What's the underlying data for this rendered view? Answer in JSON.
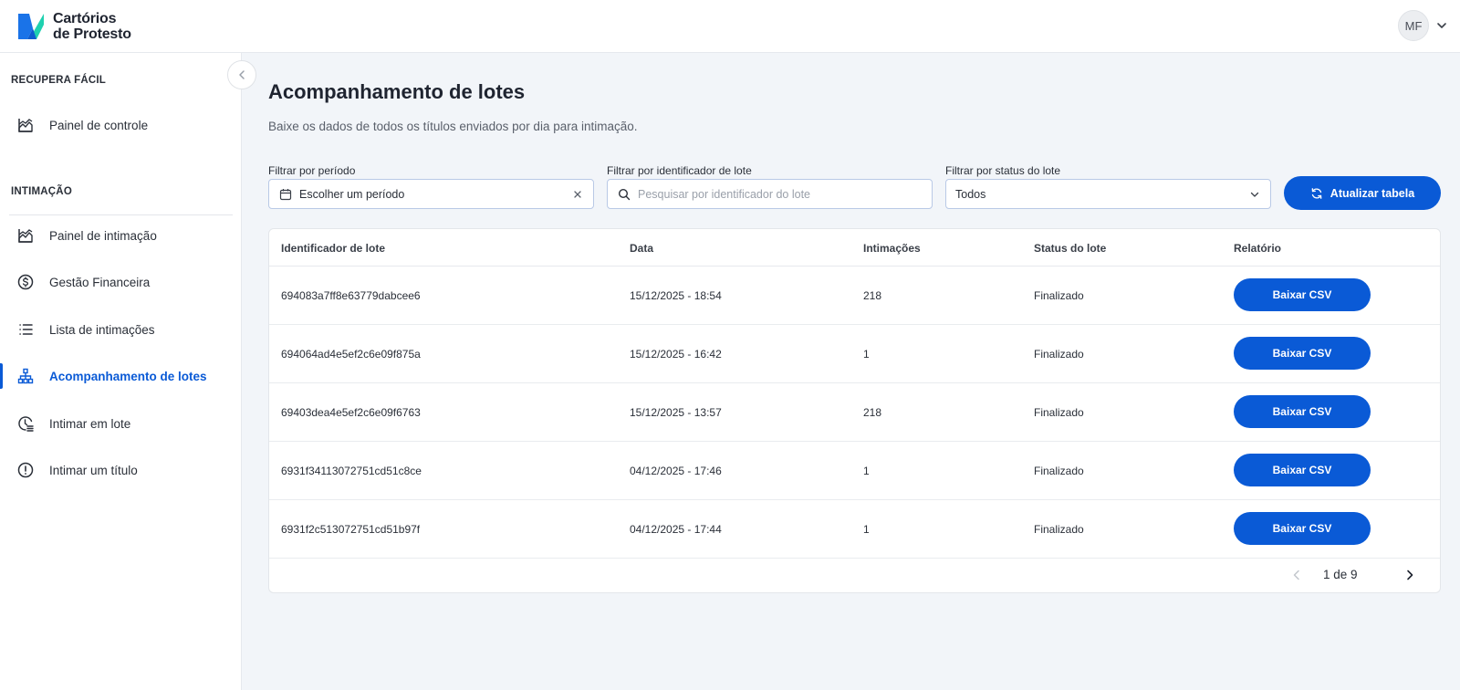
{
  "brand": {
    "name_line1": "Cartórios",
    "name_line2": "de Protesto",
    "colors": {
      "primary": "#0a5ad6",
      "logo_blue": "#1a73e8",
      "logo_teal": "#1fd1b0"
    }
  },
  "header": {
    "user_initials": "MF"
  },
  "sidebar": {
    "sections": [
      {
        "label": "RECUPERA FÁCIL",
        "items": [
          {
            "label": "Painel de controle",
            "icon": "chart-area-icon"
          }
        ]
      },
      {
        "label": "INTIMAÇÃO",
        "items": [
          {
            "label": "Painel de intimação",
            "icon": "chart-area-icon"
          },
          {
            "label": "Gestão Financeira",
            "icon": "dollar-circle-icon"
          },
          {
            "label": "Lista de intimações",
            "icon": "list-icon"
          },
          {
            "label": "Acompanhamento de lotes",
            "icon": "hierarchy-icon",
            "active": true
          },
          {
            "label": "Intimar em lote",
            "icon": "clock-list-icon"
          },
          {
            "label": "Intimar um título",
            "icon": "alert-circle-icon"
          }
        ]
      }
    ]
  },
  "main": {
    "title": "Acompanhamento de lotes",
    "subtitle": "Baixe os dados de todos os títulos enviados por dia para intimação.",
    "filters": {
      "period": {
        "label": "Filtrar por período",
        "value": "Escolher um período",
        "icon": "calendar-icon"
      },
      "identifier": {
        "label": "Filtrar por identificador de lote",
        "placeholder": "Pesquisar por identificador do lote",
        "icon": "search-icon"
      },
      "status": {
        "label": "Filtrar por status do lote",
        "value": "Todos"
      }
    },
    "refresh_label": "Atualizar tabela",
    "table": {
      "headers": [
        "Identificador de lote",
        "Data",
        "Intimações",
        "Status do lote",
        "Relatório"
      ],
      "rows": [
        {
          "id": "694083a7ff8e63779dabcee6",
          "date": "15/12/2025 - 18:54",
          "count": "218",
          "status": "Finalizado",
          "action": "Baixar CSV"
        },
        {
          "id": "694064ad4e5ef2c6e09f875a",
          "date": "15/12/2025 - 16:42",
          "count": "1",
          "status": "Finalizado",
          "action": "Baixar CSV"
        },
        {
          "id": "69403dea4e5ef2c6e09f6763",
          "date": "15/12/2025 - 13:57",
          "count": "218",
          "status": "Finalizado",
          "action": "Baixar CSV"
        },
        {
          "id": "6931f34113072751cd51c8ce",
          "date": "04/12/2025 - 17:46",
          "count": "1",
          "status": "Finalizado",
          "action": "Baixar CSV"
        },
        {
          "id": "6931f2c513072751cd51b97f",
          "date": "04/12/2025 - 17:44",
          "count": "1",
          "status": "Finalizado",
          "action": "Baixar CSV"
        }
      ]
    },
    "pagination": {
      "text": "1 de 9"
    }
  }
}
